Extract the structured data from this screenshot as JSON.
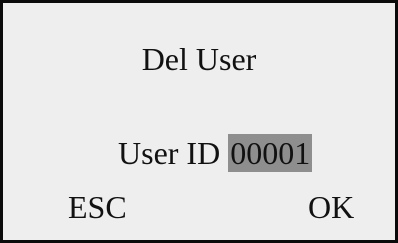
{
  "screen": {
    "title": "Del User",
    "user_id_label": "User ID",
    "user_id_value": "00001",
    "esc_label": "ESC",
    "ok_label": "OK"
  },
  "colors": {
    "background": "#eeeeee",
    "border": "#0a0a0a",
    "selection_highlight": "#8e8e8e",
    "text": "#111111"
  }
}
